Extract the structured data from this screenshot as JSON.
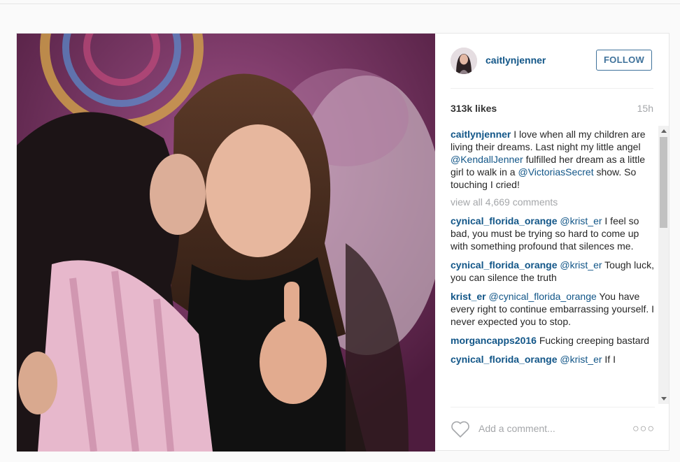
{
  "post": {
    "username": "caitlynjenner",
    "follow_label": "FOLLOW",
    "likes": "313k likes",
    "time": "15h",
    "caption": {
      "user": "caitlynjenner",
      "parts": [
        "I love when all my children are living their dreams. Last night my little angel ",
        "@KendallJenner",
        " fulfilled her dream as a little girl to walk in a ",
        "@VictoriasSecret",
        " show. So touching I cried!"
      ]
    },
    "view_all": "view all 4,669 comments",
    "comments": [
      {
        "user": "cynical_florida_orange",
        "mention": "@krist_er",
        "text": " I feel so bad, you must be trying so hard to come up with something profound that silences me."
      },
      {
        "user": "cynical_florida_orange",
        "mention": "@krist_er",
        "text": " Tough luck, you can silence the truth"
      },
      {
        "user": "krist_er",
        "mention": "@cynical_florida_orange",
        "text": " You have every right to continue embarrassing yourself. I never expected you to stop."
      },
      {
        "user": "morgancapps2016",
        "mention": "",
        "text": " Fucking creeping bastard"
      },
      {
        "user": "cynical_florida_orange",
        "mention": "@krist_er",
        "text": " If I"
      }
    ],
    "add_comment_placeholder": "Add a comment...",
    "more_label": "○○○"
  },
  "colors": {
    "link": "#125688",
    "follow": "#3f729b",
    "muted": "#a5a7aa"
  }
}
